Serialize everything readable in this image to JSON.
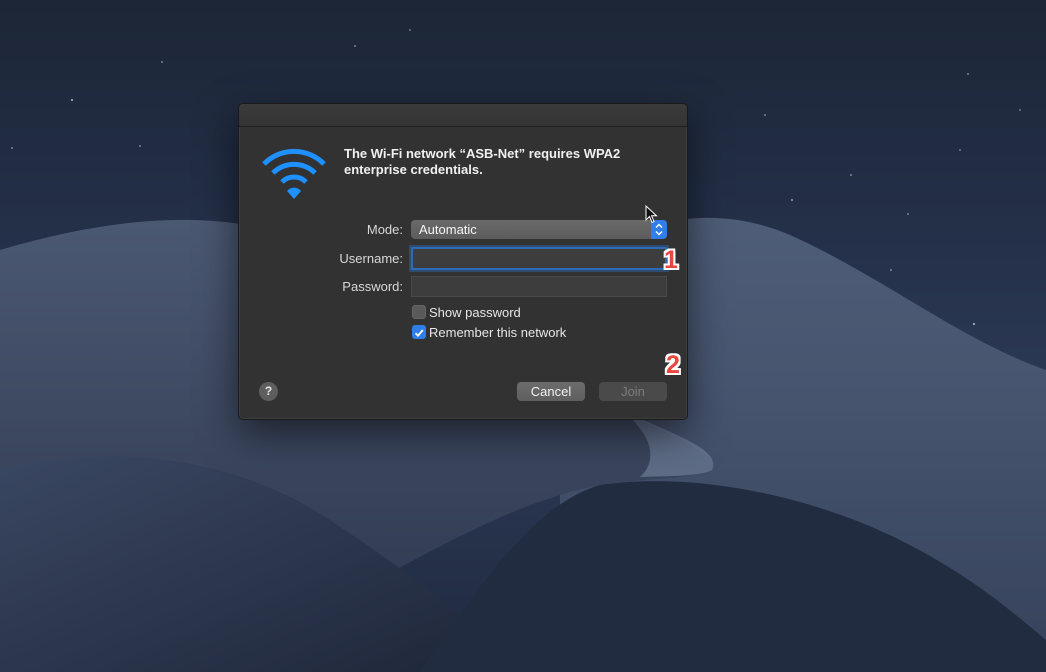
{
  "dialog": {
    "message": "The Wi-Fi network “ASB-Net” requires WPA2 enterprise credentials.",
    "mode_label": "Mode:",
    "mode_value": "Automatic",
    "username_label": "Username:",
    "username_value": "",
    "password_label": "Password:",
    "password_value": "",
    "show_password_label": "Show password",
    "show_password_checked": false,
    "remember_label": "Remember this network",
    "remember_checked": true,
    "help_label": "?",
    "cancel_label": "Cancel",
    "join_label": "Join",
    "join_enabled": false
  },
  "annotations": {
    "marker_1": "1",
    "marker_2": "2"
  },
  "icons": {
    "wifi": "wifi-icon",
    "stepper": "chevron-up-down-icon",
    "checkmark": "checkmark-icon",
    "cursor": "mouse-pointer-icon"
  },
  "colors": {
    "accent": "#2f7ee9",
    "wifi_icon": "#1e90ff",
    "marker": "#e8463f"
  }
}
